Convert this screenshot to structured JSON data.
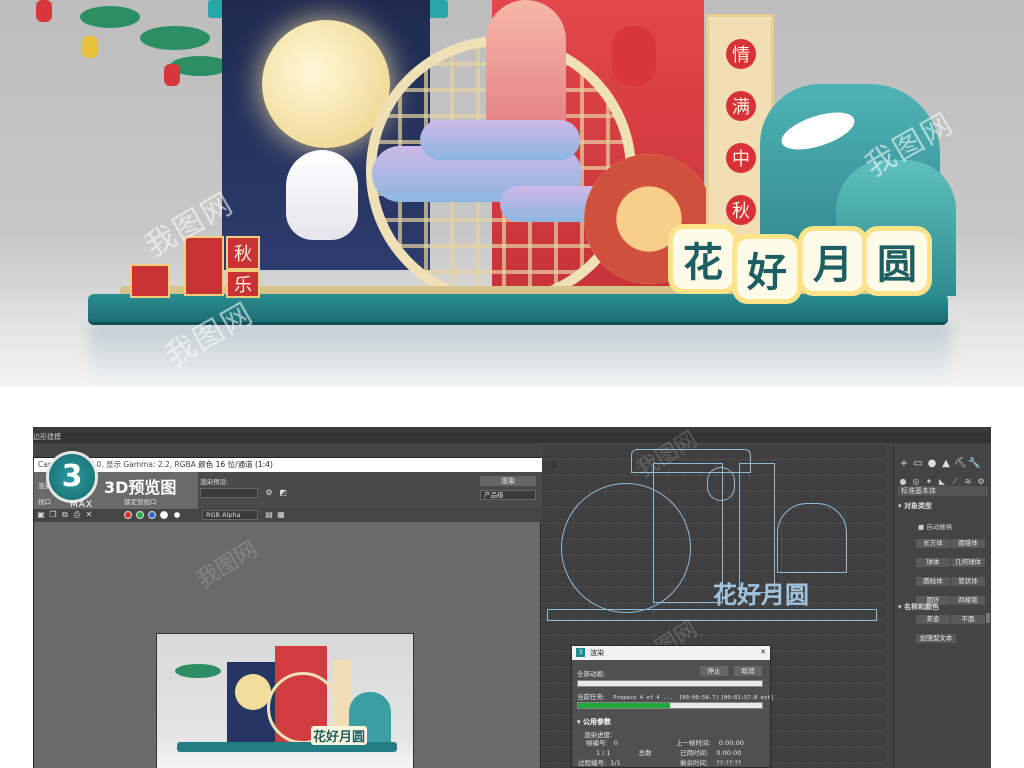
{
  "scene": {
    "lattice_chars": [
      "情",
      "满",
      "中",
      "秋"
    ],
    "sign_chars": [
      "花",
      "好",
      "月",
      "圆"
    ],
    "box_chars": [
      "秋",
      "乐"
    ],
    "watermark": "我图网"
  },
  "badge": {
    "number": "3",
    "max_label": "MAX",
    "title": "3D预览图"
  },
  "app": {
    "subbar_label": "边形建模",
    "command_panel": {
      "icons": [
        "+",
        "▭",
        "●",
        "▲",
        "⛏",
        "🔧"
      ],
      "row2": [
        "●",
        "◎",
        "✦",
        "◣",
        "⟋",
        "≋",
        "⚙"
      ],
      "dropdown": "标准基本体",
      "section_object_type": "▾ 对象类型",
      "auto_grid": "■ 自动栅格",
      "buttons": [
        "长方体",
        "圆锥体",
        "球体",
        "几何球体",
        "圆柱体",
        "管状体",
        "圆环",
        "四棱锥",
        "茶壶",
        "平面",
        "加强型文本"
      ],
      "section_name_color": "▾ 名称和颜色"
    }
  },
  "render_frame": {
    "title": "Camera001, 帧 0, 显示 Gamma: 2.2, RGBA 颜色 16 位/通道 (1:4)",
    "window_buttons": [
      "—",
      "☐",
      "✕"
    ],
    "area_label": "渲染",
    "preset_label": "渲染预设:",
    "render_button": "渲染",
    "mode_dropdown": "产品级",
    "channel_dropdown": "RGB Alpha",
    "view_label": "视口",
    "lock_label": "锁定到视口"
  },
  "render_dialog": {
    "title": "渲染",
    "stop_button": "停止",
    "cancel_button": "取消",
    "overall_label": "全部动画:",
    "overall_progress": 0.0,
    "current_task_label": "当前任务:",
    "current_task": "Prepass 4 of 4 ...",
    "elapsed": "[00:00:58.7]",
    "estimated": "[00:01:57.8 est]",
    "task_progress": 0.5,
    "section": "▾ 公用参数",
    "render_progress_label": "渲染进度:",
    "frame_label": "帧编号:",
    "frame_value": "0",
    "counter": "1 / 1",
    "total_label": "总数",
    "last_frame_label": "上一帧时间:",
    "last_frame_value": "0:00:00",
    "elapsed_label": "已用时间:",
    "elapsed_value": "0:00:00",
    "pass_label": "过程编号:",
    "pass_value": "1/1",
    "remaining_label": "剩余时间:",
    "remaining_value": "??:??:??"
  }
}
